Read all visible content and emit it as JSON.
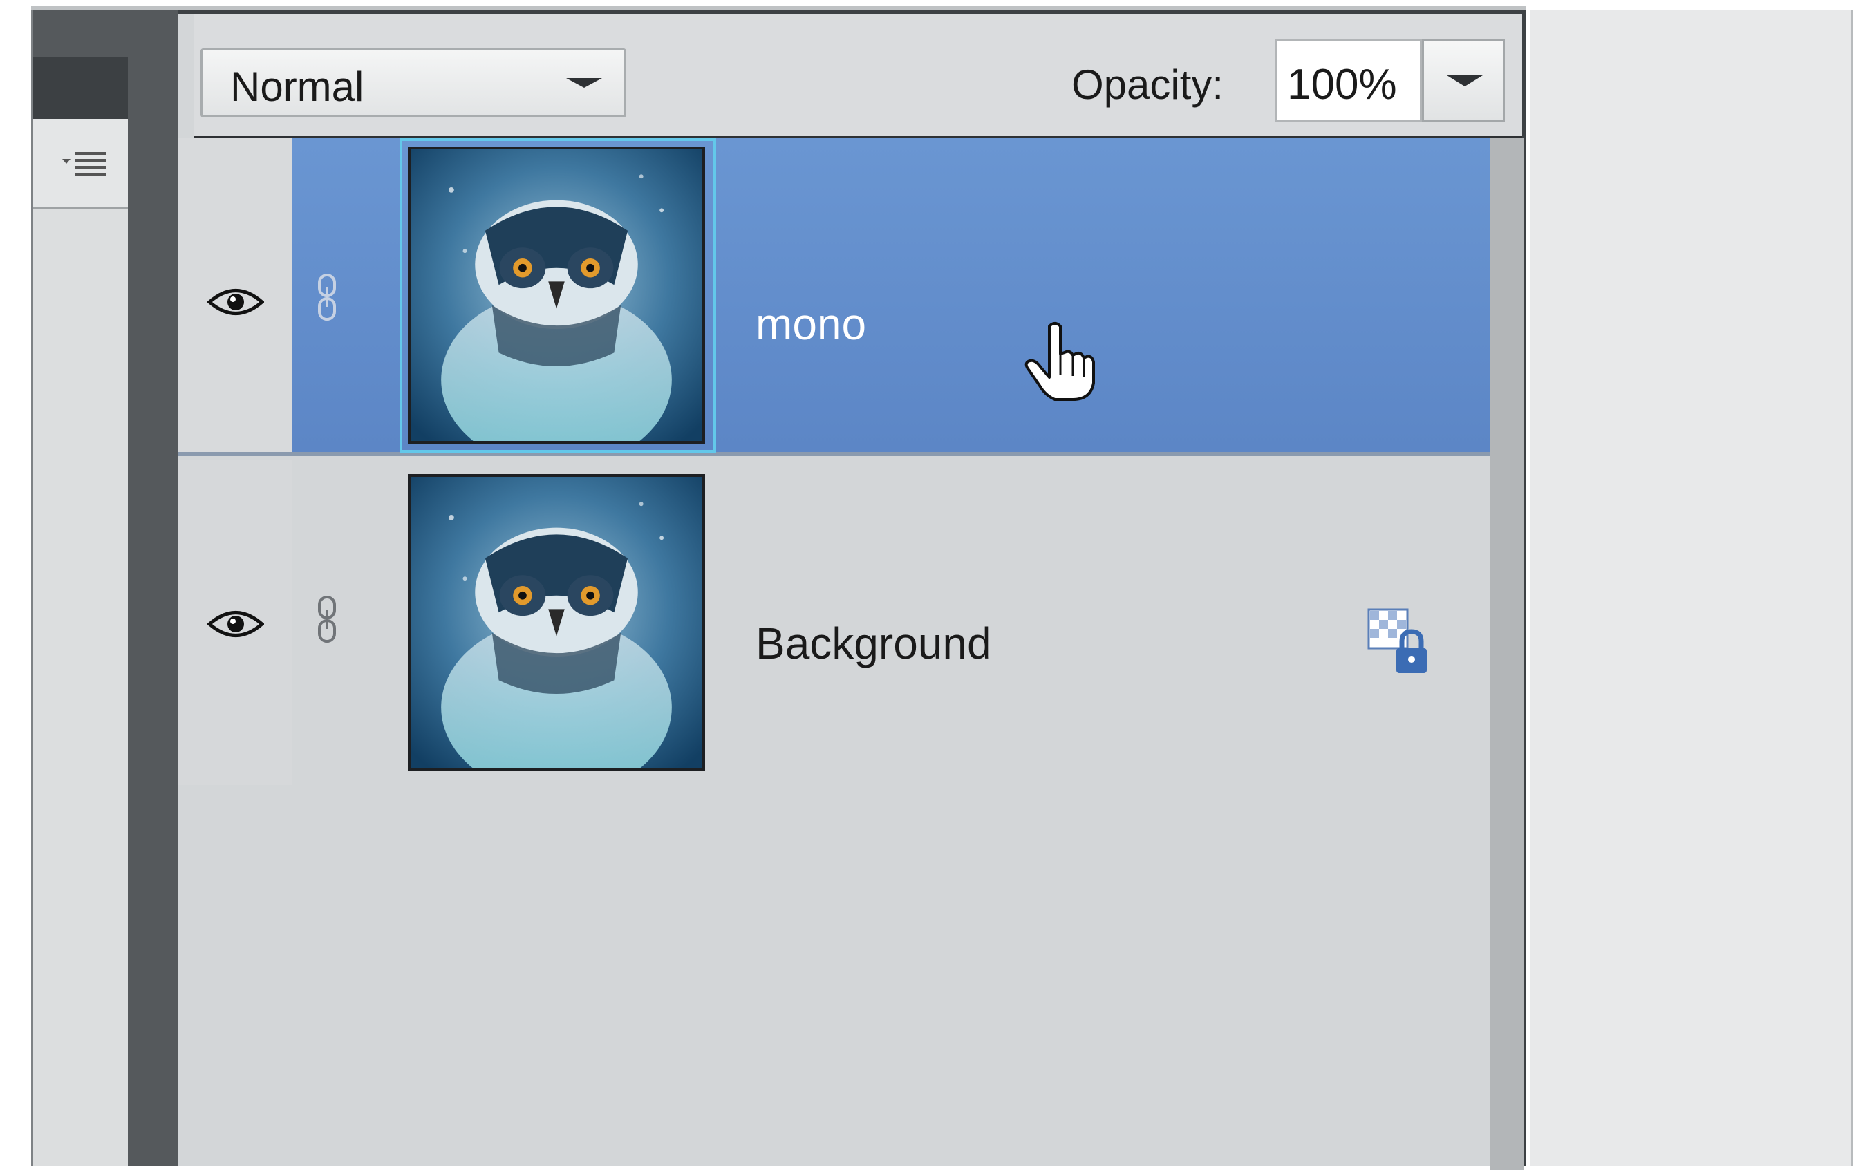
{
  "layers_panel": {
    "blend_mode": "Normal",
    "opacity_label": "Opacity:",
    "opacity_value": "100%",
    "layers": [
      {
        "name": "mono",
        "visible": true,
        "selected": true
      },
      {
        "name": "Background",
        "visible": true,
        "selected": false,
        "locked": true
      }
    ]
  },
  "icons": {
    "panel_menu": "panel-menu-icon",
    "visibility": "eye-icon",
    "link": "link-icon",
    "lock": "transparency-lock-icon",
    "cursor": "hand-cursor-icon"
  },
  "colors": {
    "selected_row": "#6890cf",
    "thumb_highlight": "#63c8ea",
    "panel_bg": "#d3d6d8"
  }
}
